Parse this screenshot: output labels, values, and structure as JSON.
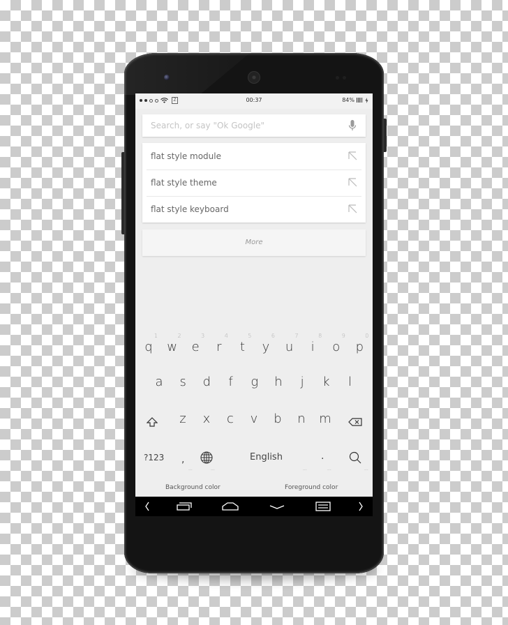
{
  "status_bar": {
    "signal_dots_filled": 2,
    "signal_dots_empty": 2,
    "carrier_badge": "Z",
    "time": "00:37",
    "battery": "84%"
  },
  "search": {
    "placeholder": "Search, or say \"Ok Google\"",
    "mic_icon": "microphone-icon"
  },
  "suggestions": [
    {
      "label": "flat style module",
      "icon": "arrow-up-left-icon"
    },
    {
      "label": "flat style theme",
      "icon": "arrow-up-left-icon"
    },
    {
      "label": "flat style keyboard",
      "icon": "arrow-up-left-icon"
    }
  ],
  "more_label": "More",
  "keyboard": {
    "row1": [
      {
        "k": "q",
        "h": "1"
      },
      {
        "k": "w",
        "h": "2"
      },
      {
        "k": "e",
        "h": "3"
      },
      {
        "k": "r",
        "h": "4"
      },
      {
        "k": "t",
        "h": "5"
      },
      {
        "k": "y",
        "h": "6"
      },
      {
        "k": "u",
        "h": "7"
      },
      {
        "k": "i",
        "h": "8"
      },
      {
        "k": "o",
        "h": "9"
      },
      {
        "k": "p",
        "h": "0"
      }
    ],
    "row2": [
      "a",
      "s",
      "d",
      "f",
      "g",
      "h",
      "j",
      "k",
      "l"
    ],
    "row3": [
      "z",
      "x",
      "c",
      "v",
      "b",
      "n",
      "m"
    ],
    "symbols_label": "?123",
    "comma": ",",
    "space_label": "English",
    "period": ".",
    "more_dots": "...",
    "shift_icon": "shift-icon",
    "backspace_icon": "backspace-icon",
    "globe_icon": "globe-icon",
    "search_icon": "search-icon"
  },
  "color_options": {
    "background": "Background color",
    "foreground": "Foreground color"
  },
  "nav_bar": [
    "chevron-left-icon",
    "recents-icon",
    "home-icon",
    "hide-keyboard-icon",
    "menu-icon",
    "chevron-right-icon"
  ]
}
